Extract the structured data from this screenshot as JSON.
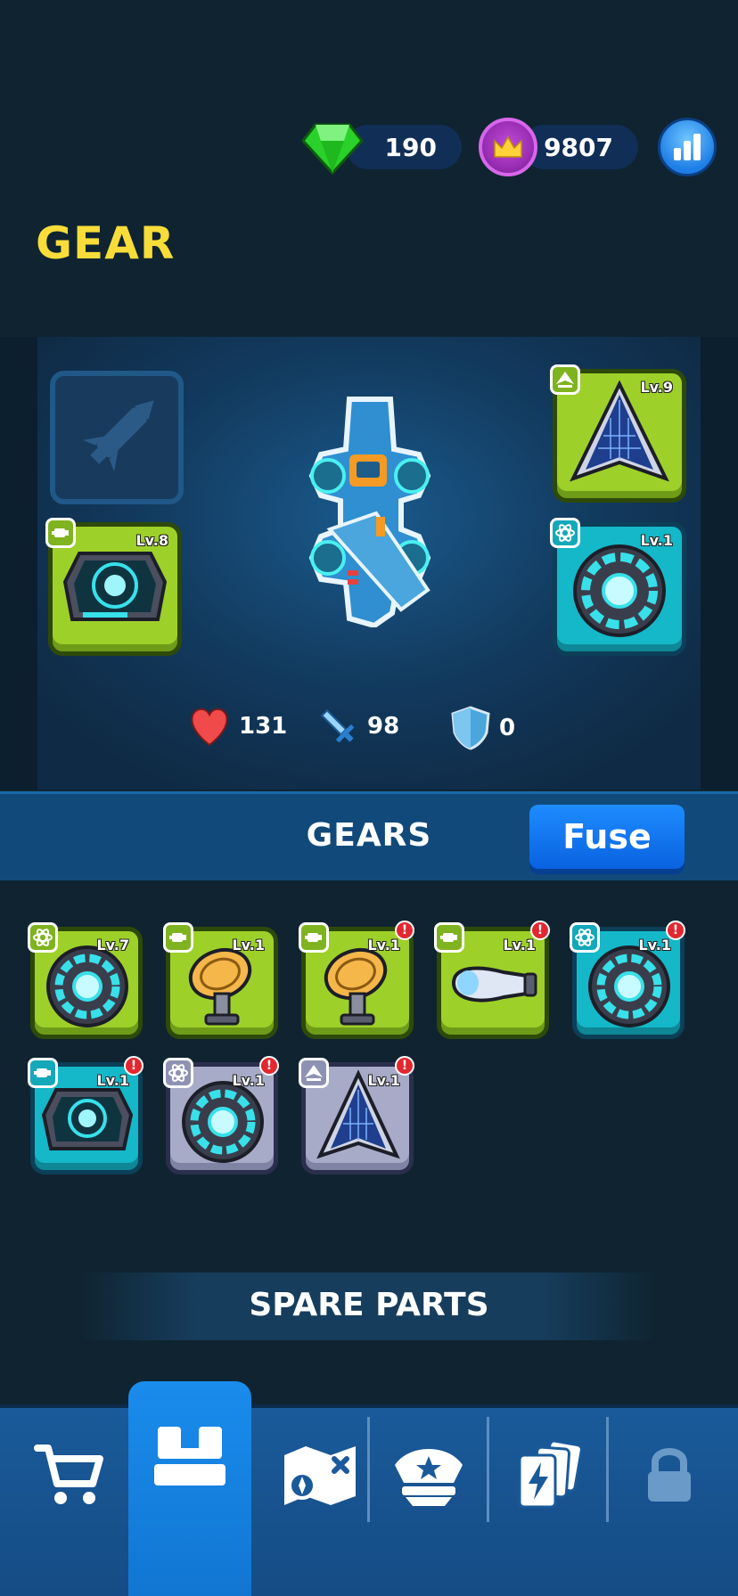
{
  "currency": {
    "gems": "190",
    "crowns": "9807"
  },
  "page_title": "GEAR",
  "equipped": {
    "engine_slot": {
      "level": "Lv.8"
    },
    "wing_slot": {
      "level": "Lv.9"
    },
    "reactor_slot": {
      "level": "Lv.1"
    }
  },
  "ship_stats": {
    "health": "131",
    "attack": "98",
    "defense": "0"
  },
  "gears_section": {
    "title": "GEARS",
    "fuse_label": "Fuse"
  },
  "inventory": [
    {
      "level": "Lv.7",
      "rarity": "green",
      "type": "reactor",
      "alert": ""
    },
    {
      "level": "Lv.1",
      "rarity": "green",
      "type": "engine",
      "alert": ""
    },
    {
      "level": "Lv.1",
      "rarity": "green",
      "type": "engine",
      "alert": "!"
    },
    {
      "level": "Lv.1",
      "rarity": "green",
      "type": "engine",
      "alert": "!"
    },
    {
      "level": "Lv.1",
      "rarity": "cyan",
      "type": "reactor",
      "alert": "!"
    },
    {
      "level": "Lv.1",
      "rarity": "cyan",
      "type": "engine",
      "alert": "!"
    },
    {
      "level": "Lv.1",
      "rarity": "gray",
      "type": "reactor",
      "alert": "!"
    },
    {
      "level": "Lv.1",
      "rarity": "gray",
      "type": "wing",
      "alert": "!"
    }
  ],
  "spare_parts": {
    "title": "SPARE PARTS"
  },
  "colors": {
    "title_yellow": "#f8dc3a",
    "rarity_green": "#9ed02a",
    "rarity_cyan": "#14b8c8",
    "rarity_gray": "#a7abc7",
    "fuse_blue": "#1e8cff"
  },
  "nav": [
    "cart-icon",
    "gear-hangar-icon",
    "map-icon",
    "captain-icon",
    "cards-icon",
    "lock-icon"
  ]
}
